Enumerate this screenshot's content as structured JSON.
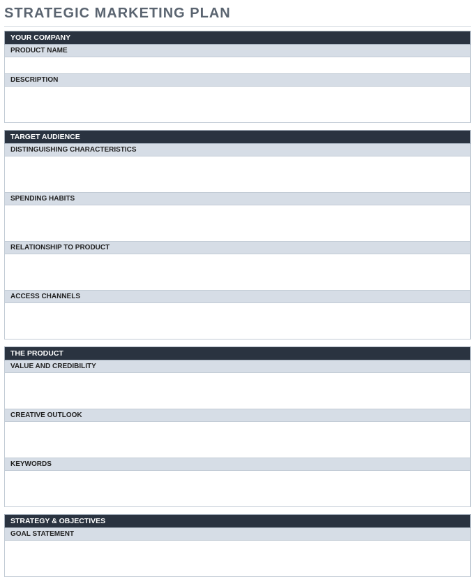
{
  "title": "STRATEGIC MARKETING PLAN",
  "sections": [
    {
      "header": "YOUR COMPANY",
      "fields": [
        {
          "label": "PRODUCT NAME",
          "value": "",
          "height": "short"
        },
        {
          "label": "DESCRIPTION",
          "value": "",
          "height": "tall"
        }
      ]
    },
    {
      "header": "TARGET AUDIENCE",
      "fields": [
        {
          "label": "DISTINGUISHING CHARACTERISTICS",
          "value": "",
          "height": "tall"
        },
        {
          "label": "SPENDING HABITS",
          "value": "",
          "height": "tall"
        },
        {
          "label": "RELATIONSHIP TO PRODUCT",
          "value": "",
          "height": "tall"
        },
        {
          "label": "ACCESS CHANNELS",
          "value": "",
          "height": "tall"
        }
      ]
    },
    {
      "header": "THE PRODUCT",
      "fields": [
        {
          "label": "VALUE AND CREDIBILITY",
          "value": "",
          "height": "tall"
        },
        {
          "label": "CREATIVE OUTLOOK",
          "value": "",
          "height": "tall"
        },
        {
          "label": "KEYWORDS",
          "value": "",
          "height": "tall"
        }
      ]
    },
    {
      "header": "STRATEGY & OBJECTIVES",
      "fields": [
        {
          "label": "GOAL STATEMENT",
          "value": "",
          "height": "tall"
        }
      ]
    }
  ]
}
